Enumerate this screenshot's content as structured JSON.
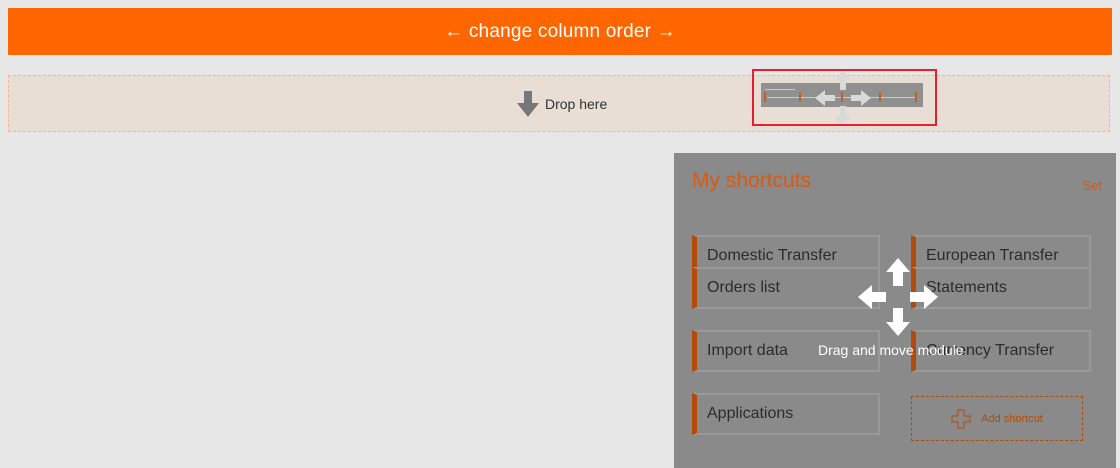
{
  "header": {
    "title": "← change column order →"
  },
  "dropzone": {
    "label": "Drop here"
  },
  "module": {
    "title": "My shortcuts",
    "set_label": "Set",
    "shortcuts": [
      "Domestic Transfer",
      "European Transfer",
      "Orders list",
      "Statements",
      "Import data",
      "Currency Transfer",
      "Applications"
    ],
    "add_shortcut_label": "Add shortcut",
    "drag_hint": "Drag and move module"
  },
  "colors": {
    "accent": "#ff6600",
    "module_accent": "#d95a10",
    "highlight": "#e8202e"
  },
  "icons": [
    "arrow-down-icon",
    "move-arrows-icon",
    "plus-icon"
  ]
}
